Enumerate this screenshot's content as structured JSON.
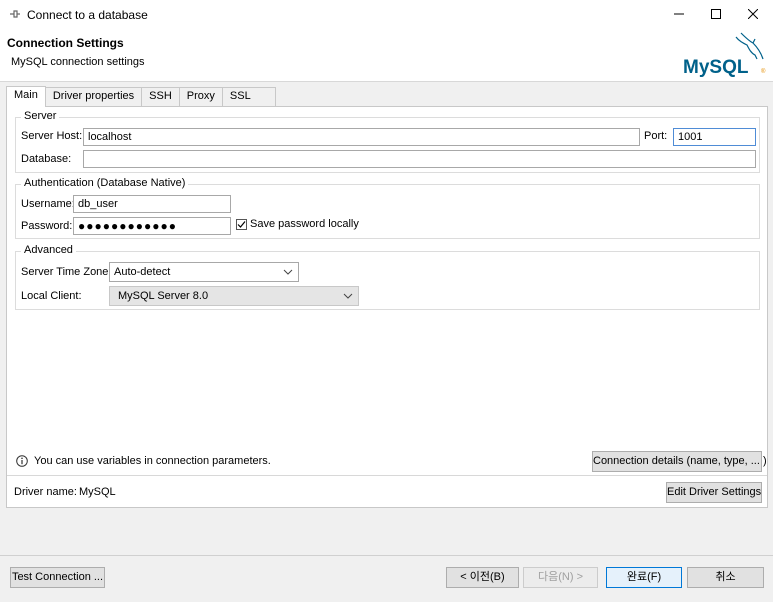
{
  "window": {
    "title": "Connect to a database"
  },
  "header": {
    "title": "Connection Settings",
    "subtitle": "MySQL connection settings",
    "logo_text": "MySQL"
  },
  "tabs": [
    {
      "label": "Main",
      "active": true
    },
    {
      "label": "Driver properties",
      "active": false
    },
    {
      "label": "SSH",
      "active": false
    },
    {
      "label": "Proxy",
      "active": false
    },
    {
      "label": "SSL",
      "active": false
    }
  ],
  "server": {
    "legend": "Server",
    "host_label": "Server Host:",
    "host_value": "localhost",
    "port_label": "Port:",
    "port_value": "1001",
    "database_label": "Database:",
    "database_value": ""
  },
  "auth": {
    "legend": "Authentication (Database Native)",
    "username_label": "Username:",
    "username_value": "db_user",
    "password_label": "Password:",
    "password_value": "●●●●●●●●●●●●",
    "save_password_label": "Save password locally",
    "save_password_checked": true
  },
  "advanced": {
    "legend": "Advanced",
    "timezone_label": "Server Time Zone:",
    "timezone_value": "Auto-detect",
    "client_label": "Local Client:",
    "client_value": "MySQL Server 8.0"
  },
  "info": {
    "variables_hint": "You can use variables in connection parameters.",
    "connection_details_button": "Connection details (name, type, ... )",
    "driver_name_label": "Driver name:",
    "driver_name_value": "MySQL",
    "edit_driver_button": "Edit Driver Settings"
  },
  "footer": {
    "test_connection": "Test Connection ...",
    "back": "< 이전(B)",
    "next": "다음(N) >",
    "finish": "완료(F)",
    "cancel": "취소"
  },
  "colors": {
    "mysql_blue": "#00618a",
    "mysql_orange": "#e48e00",
    "focus_border": "#4f8cd6"
  }
}
